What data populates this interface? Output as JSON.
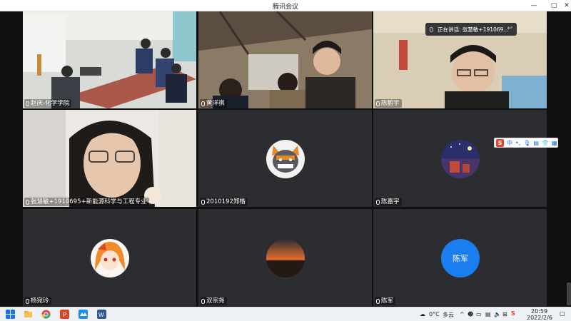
{
  "window": {
    "title": "腾讯会议"
  },
  "window_controls": {
    "minimize": "—",
    "maximize": "▢",
    "close": "✕"
  },
  "participants": [
    {
      "name": "赵庆-化学学院",
      "type": "video"
    },
    {
      "name": "黄洋祺",
      "type": "video"
    },
    {
      "name": "陈鹏宇",
      "type": "video"
    },
    {
      "name": "张慧敏+1910695+新能源科学与工程专业",
      "type": "video",
      "active": true
    },
    {
      "name": "2010192郑楷",
      "type": "avatar"
    },
    {
      "name": "陈嘉宇",
      "type": "avatar"
    },
    {
      "name": "杨宛玲",
      "type": "avatar"
    },
    {
      "name": "双宗尧",
      "type": "avatar"
    },
    {
      "name": "陈军",
      "type": "avatar",
      "avatar_text": "陈军"
    }
  ],
  "speaking_toast": {
    "text": "正在讲话: 张慧敏+191069..."
  },
  "ime_bar": {
    "logo": "S",
    "mode": "中",
    "punct": "•,",
    "mic": "🎙",
    "keyboard": "▤",
    "skin": "👕",
    "menu": "▦"
  },
  "taskbar": {
    "weather_temp": "0°C",
    "weather_desc": "多云",
    "tray_chevron": "^",
    "time": "20:59",
    "date": "2022/2/6"
  },
  "colors": {
    "accent_blue": "#1a7df0",
    "active_border": "#2fbf71",
    "tile_bg": "#2c2d31"
  }
}
